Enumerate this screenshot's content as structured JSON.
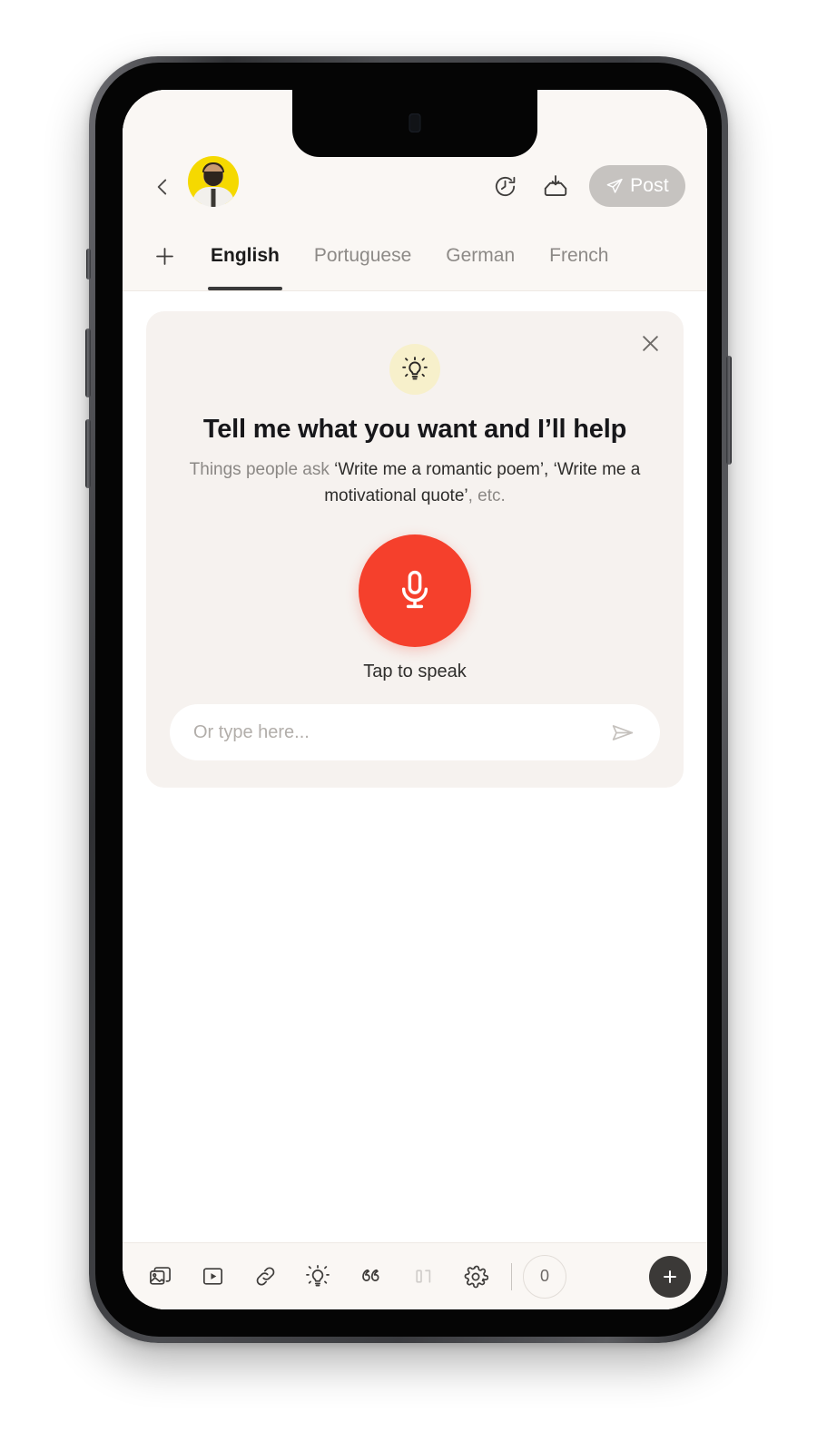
{
  "topbar": {
    "back_icon": "chevron-left-icon",
    "avatar_label": "User avatar",
    "history_icon": "clock-restore-icon",
    "inbox_icon": "inbox-download-icon",
    "post_label": "Post",
    "post_icon": "paper-plane-icon",
    "post_disabled_color": "#c6c3c0"
  },
  "tabs": {
    "add_icon": "plus-icon",
    "items": [
      {
        "label": "English",
        "active": true
      },
      {
        "label": "Portuguese",
        "active": false
      },
      {
        "label": "German",
        "active": false
      },
      {
        "label": "French",
        "active": false
      }
    ]
  },
  "assistant_card": {
    "close_icon": "close-icon",
    "badge_icon": "lightbulb-icon",
    "badge_color": "#f7f0cb",
    "title": "Tell me what you want and I’ll help",
    "subtitle_lead": "Things people ask ",
    "subtitle_example_1": "‘Write me a romantic poem’,",
    "subtitle_example_2": "‘Write me a motivational quote’",
    "subtitle_tail": ", etc.",
    "mic_icon": "microphone-icon",
    "mic_color": "#f5402c",
    "mic_label": "Tap to speak",
    "input_placeholder": "Or type here...",
    "input_value": "",
    "send_icon": "send-icon",
    "card_background": "#f6f2ef"
  },
  "bottombar": {
    "tools": [
      {
        "name": "gallery-icon"
      },
      {
        "name": "video-icon"
      },
      {
        "name": "link-icon"
      },
      {
        "name": "lightbulb-icon"
      },
      {
        "name": "quote-icon"
      },
      {
        "name": "text-format-icon"
      },
      {
        "name": "settings-gear-icon"
      }
    ],
    "count": "0",
    "add_icon": "plus-icon",
    "add_color": "#3b3937"
  }
}
